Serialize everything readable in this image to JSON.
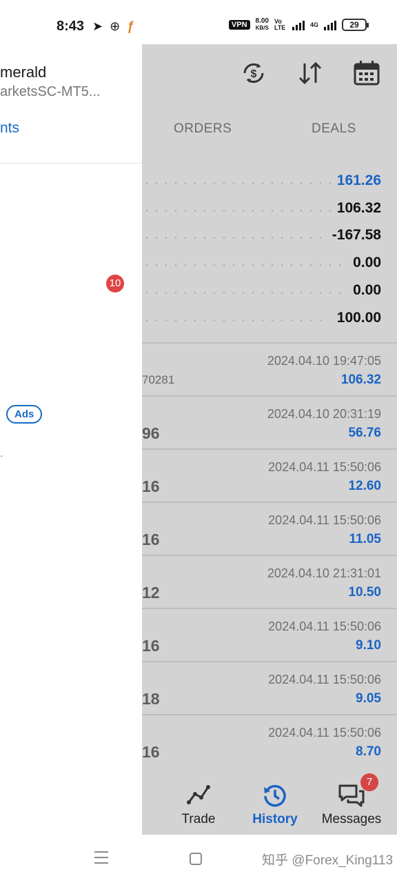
{
  "status_bar": {
    "time": "8:43",
    "vpn": "VPN",
    "speed_value": "8.00",
    "speed_unit": "KB/S",
    "volte": "Vo LTE",
    "network": "4G",
    "battery": "29"
  },
  "drawer": {
    "account_name": "merald",
    "server": "arketsSC-MT5...",
    "link": "nts",
    "badge": "10",
    "ads": "Ads"
  },
  "tabs": [
    {
      "label": "ORDERS"
    },
    {
      "label": "DEALS"
    }
  ],
  "summary": [
    {
      "value": "161.26",
      "highlight": true
    },
    {
      "value": "106.32",
      "highlight": false
    },
    {
      "value": "-167.58",
      "highlight": false
    },
    {
      "value": "0.00",
      "highlight": false
    },
    {
      "value": "0.00",
      "highlight": false
    },
    {
      "value": "100.00",
      "highlight": false
    }
  ],
  "deals": [
    {
      "left": "70281",
      "time": "2024.04.10 19:47:05",
      "profit": "106.32"
    },
    {
      "left": "96",
      "time": "2024.04.10 20:31:19",
      "profit": "56.76"
    },
    {
      "left": "16",
      "time": "2024.04.11 15:50:06",
      "profit": "12.60"
    },
    {
      "left": "16",
      "time": "2024.04.11 15:50:06",
      "profit": "11.05"
    },
    {
      "left": "12",
      "time": "2024.04.10 21:31:01",
      "profit": "10.50"
    },
    {
      "left": "16",
      "time": "2024.04.11 15:50:06",
      "profit": "9.10"
    },
    {
      "left": "18",
      "time": "2024.04.11 15:50:06",
      "profit": "9.05"
    },
    {
      "left": "16",
      "time": "2024.04.11 15:50:06",
      "profit": "8.70"
    }
  ],
  "bottom_nav": {
    "trade": "Trade",
    "history": "History",
    "messages": "Messages",
    "messages_badge": "7"
  },
  "watermark": "知乎 @Forex_King113",
  "colors": {
    "accent_blue": "#1a63c6",
    "badge_red": "#e04444",
    "panel_gray": "#d3d3d3"
  }
}
